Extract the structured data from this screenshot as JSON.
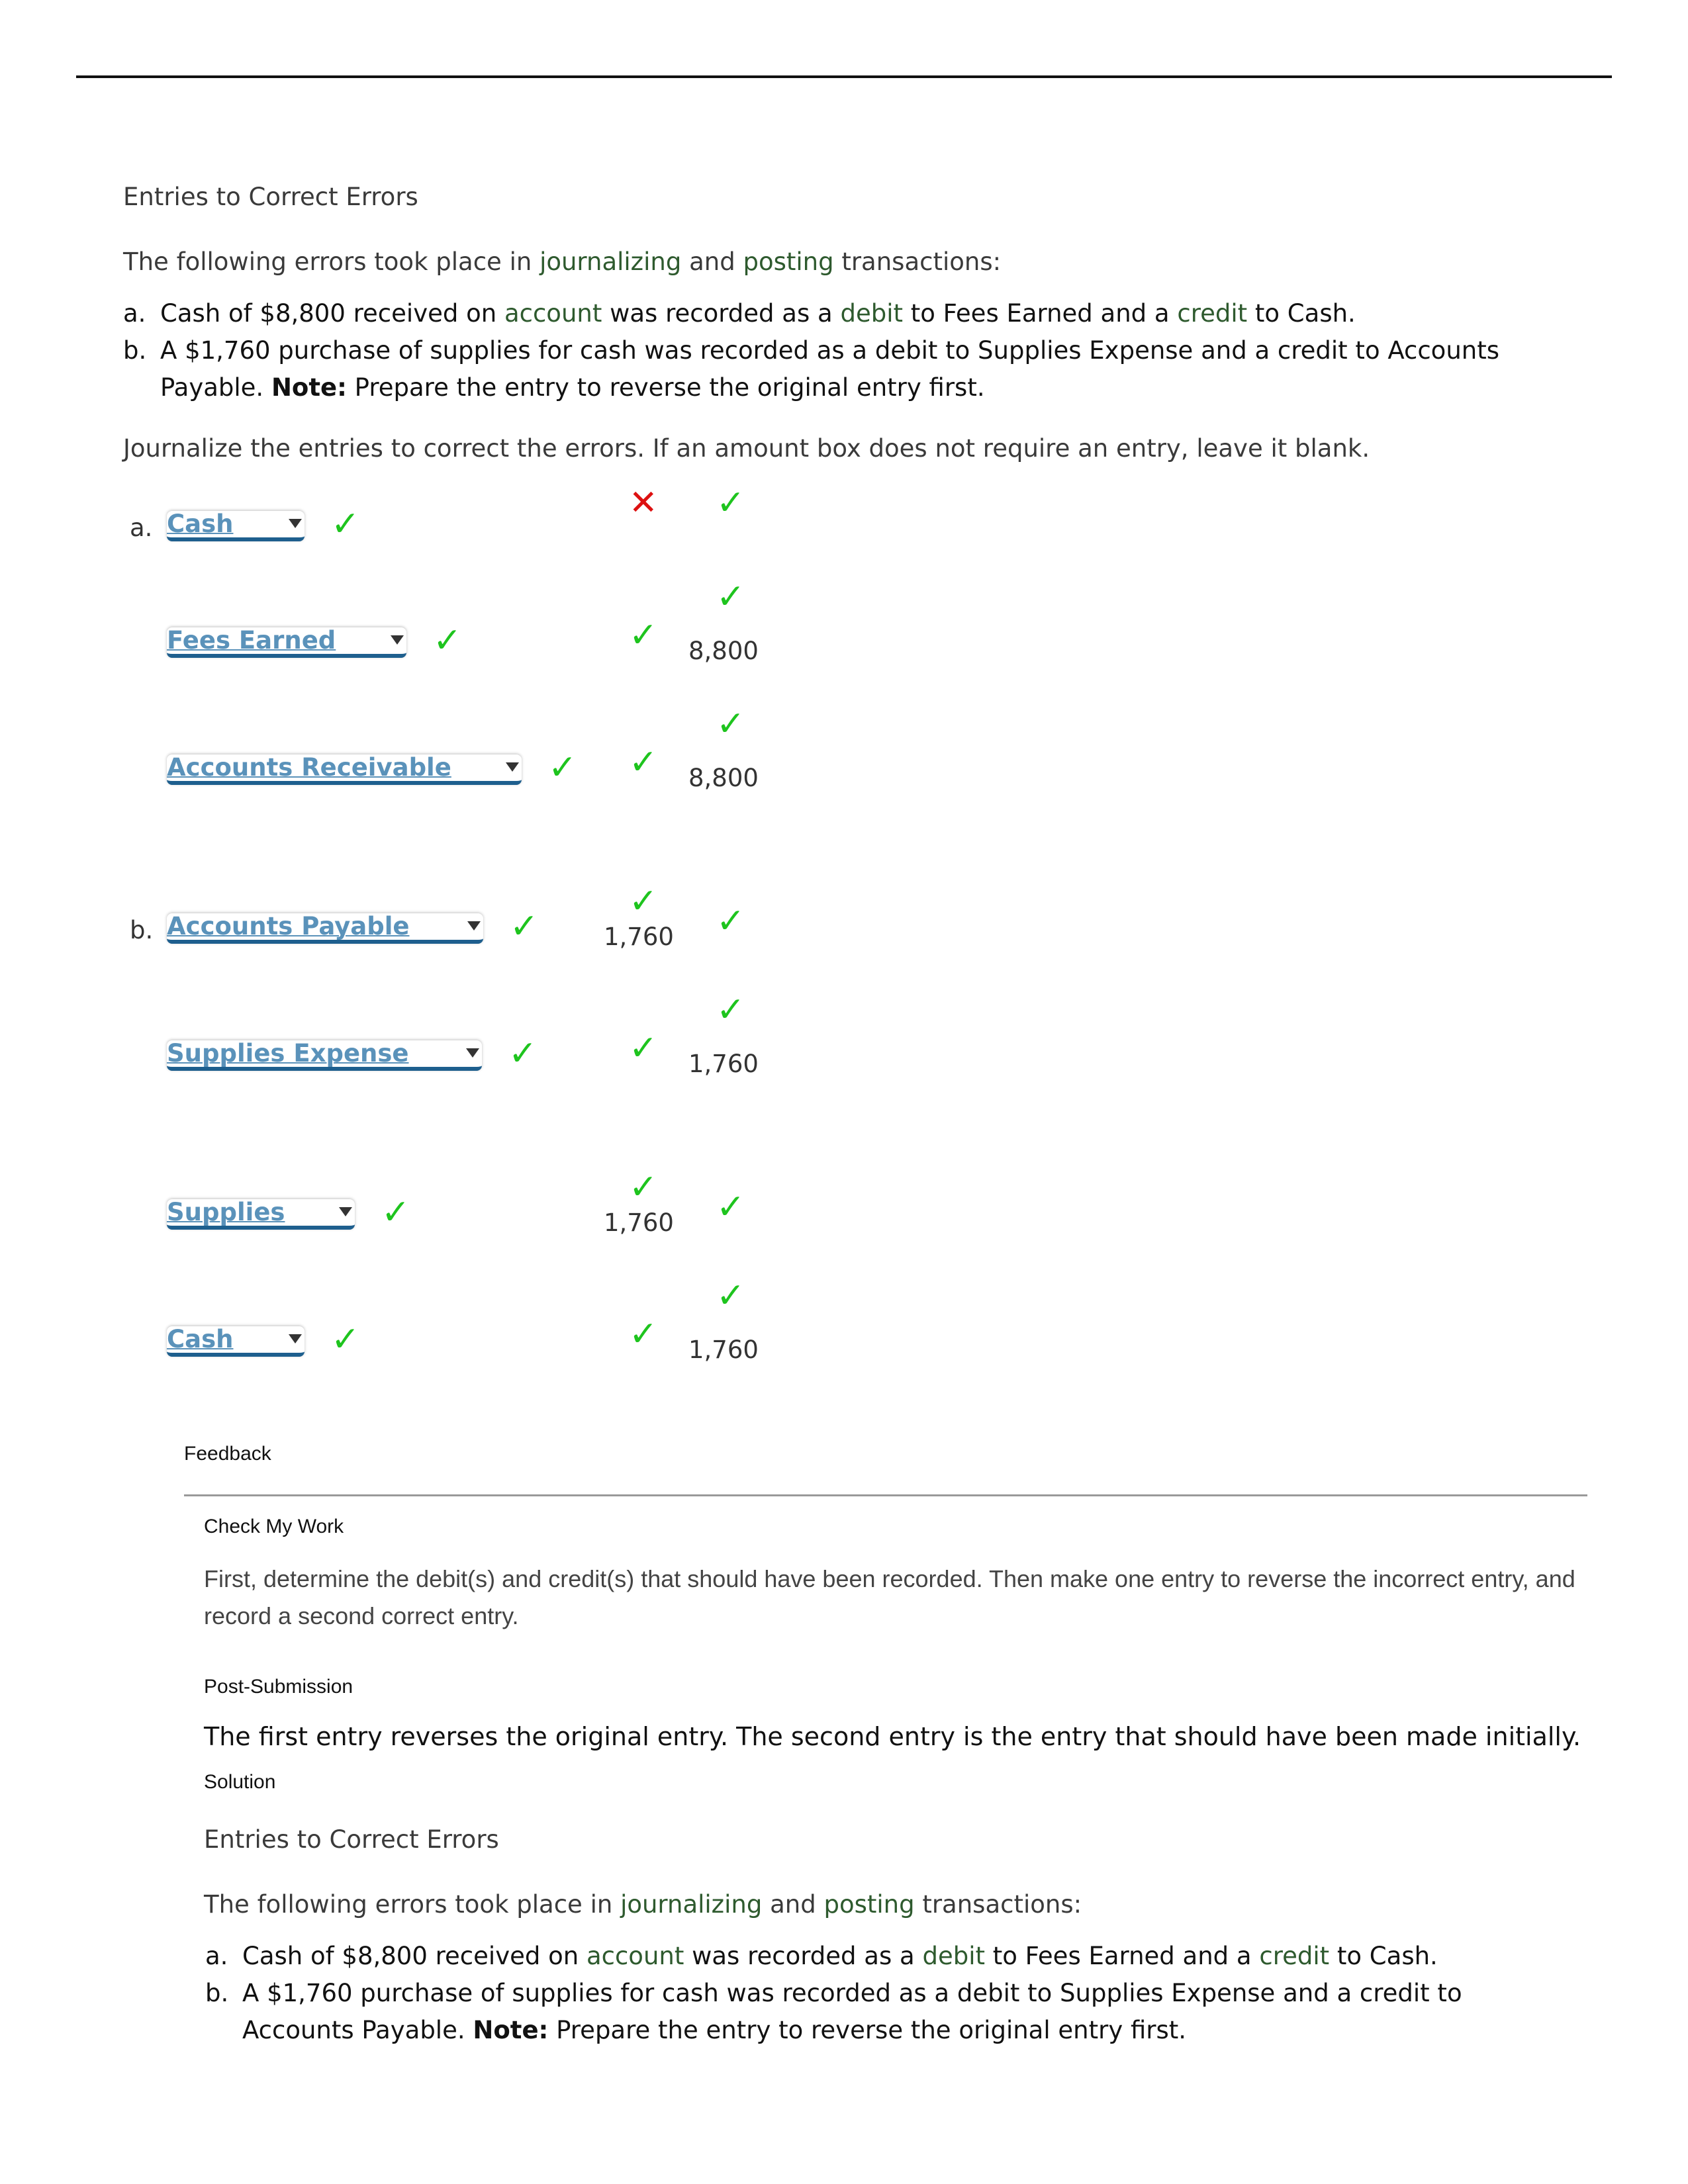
{
  "page": {
    "title": "Entries to Correct Errors"
  },
  "problem": {
    "intro_pre": "The following errors took place in ",
    "intro_hl1": "journalizing",
    "intro_mid": " and ",
    "intro_hl2": "posting",
    "intro_post": " transactions:",
    "items": [
      {
        "label": "a.",
        "p1": "Cash of $8,800 received on ",
        "h1": "account",
        "p2": " was recorded as a ",
        "h2": "debit",
        "p3": " to Fees Earned and a ",
        "h3": "credit",
        "p4": " to Cash."
      },
      {
        "label": "b.",
        "text1": "A $1,760 purchase of supplies for cash was recorded as a debit to Supplies Expense and a credit to Accounts",
        "text2": "Payable.",
        "note_label": "Note:",
        "note_text": " Prepare the entry to reverse the original entry first."
      }
    ],
    "instruction": "Journalize the entries to correct the errors. If an amount box does not require an entry, leave it blank."
  },
  "journal": {
    "entries": [
      {
        "letter": "a.",
        "lines": [
          {
            "account": "Cash",
            "debit": "",
            "credit": "",
            "account_status": "correct",
            "debit_status": "incorrect",
            "credit_status": "correct"
          },
          {
            "account": "Fees Earned",
            "debit": "",
            "credit": "8,800",
            "account_status": "correct",
            "debit_status": "correct",
            "credit_status": "correct"
          },
          {
            "account": "Accounts Receivable",
            "debit": "",
            "credit": "8,800",
            "account_status": "correct",
            "debit_status": "correct",
            "credit_status": "correct"
          }
        ]
      },
      {
        "letter": "b.",
        "lines": [
          {
            "account": "Accounts Payable",
            "debit": "1,760",
            "credit": "",
            "account_status": "correct",
            "debit_status": "correct",
            "credit_status": "correct"
          },
          {
            "account": "Supplies Expense",
            "debit": "",
            "credit": "1,760",
            "account_status": "correct",
            "debit_status": "correct",
            "credit_status": "correct"
          },
          {
            "account": "Supplies",
            "debit": "1,760",
            "credit": "",
            "account_status": "correct",
            "debit_status": "correct",
            "credit_status": "correct"
          },
          {
            "account": "Cash",
            "debit": "",
            "credit": "1,760",
            "account_status": "correct",
            "debit_status": "correct",
            "credit_status": "correct"
          }
        ]
      }
    ],
    "check_glyph": "✓",
    "cross_glyph": "✕"
  },
  "feedback": {
    "label": "Feedback",
    "check_my_work_label": "Check My Work",
    "check_my_work_text": "First, determine the debit(s) and credit(s) that should have been recorded. Then make one entry to reverse the incorrect entry, and record a second correct entry.",
    "post_submission_label": "Post-Submission",
    "post_submission_text": "The first entry reverses the original entry. The second entry is the entry that should have been made initially.",
    "solution_label": "Solution"
  },
  "solution": {
    "title": "Entries to Correct Errors",
    "intro_pre": "The following errors took place in ",
    "intro_hl1": "journalizing",
    "intro_mid": " and ",
    "intro_hl2": "posting",
    "intro_post": " transactions:",
    "item_b_text1": "A $1,760 purchase of supplies for cash was recorded as a debit to Supplies Expense and a credit to",
    "item_b_text2": "Accounts Payable."
  },
  "colors": {
    "check": "#1ec41e",
    "cross": "#dd1111",
    "link_green": "#2e5a2e",
    "dropdown_text": "#5a92ba",
    "dropdown_underline": "#1e5f8e"
  }
}
